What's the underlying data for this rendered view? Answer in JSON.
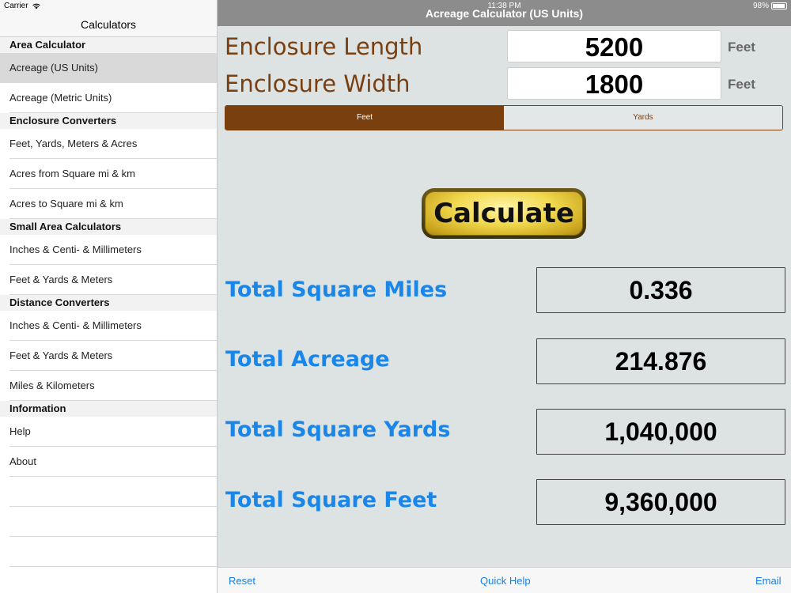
{
  "status": {
    "carrier": "Carrier",
    "time": "11:38 PM",
    "battery": "98%"
  },
  "sidebar": {
    "title": "Calculators",
    "sections": [
      {
        "header": "Area Calculator",
        "items": [
          "Acreage (US Units)",
          "Acreage (Metric Units)"
        ]
      },
      {
        "header": "Enclosure Converters",
        "items": [
          "Feet, Yards, Meters & Acres",
          "Acres from Square mi & km",
          "Acres to Square mi & km"
        ]
      },
      {
        "header": "Small Area Calculators",
        "items": [
          "Inches & Centi- & Millimeters",
          "Feet & Yards & Meters"
        ]
      },
      {
        "header": "Distance Converters",
        "items": [
          "Inches & Centi- & Millimeters",
          "Feet & Yards & Meters",
          "Miles & Kilometers"
        ]
      },
      {
        "header": "Information",
        "items": [
          "Help",
          "About"
        ]
      }
    ],
    "selected_item": "Acreage (US Units)"
  },
  "main": {
    "title": "Acreage Calculator (US Units)",
    "length": {
      "label": "Enclosure Length",
      "value": "5200",
      "unit": "Feet"
    },
    "width": {
      "label": "Enclosure Width",
      "value": "1800",
      "unit": "Feet"
    },
    "segments": {
      "options": [
        "Feet",
        "Yards"
      ],
      "selected": "Feet"
    },
    "calculate_label": "Calculate",
    "results": [
      {
        "label": "Total Square Miles",
        "value": "0.336"
      },
      {
        "label": "Total Acreage",
        "value": "214.876"
      },
      {
        "label": "Total Square Yards",
        "value": "1,040,000"
      },
      {
        "label": "Total Square Feet",
        "value": "9,360,000"
      }
    ]
  },
  "toolbar": {
    "reset": "Reset",
    "quick_help": "Quick Help",
    "email": "Email"
  }
}
